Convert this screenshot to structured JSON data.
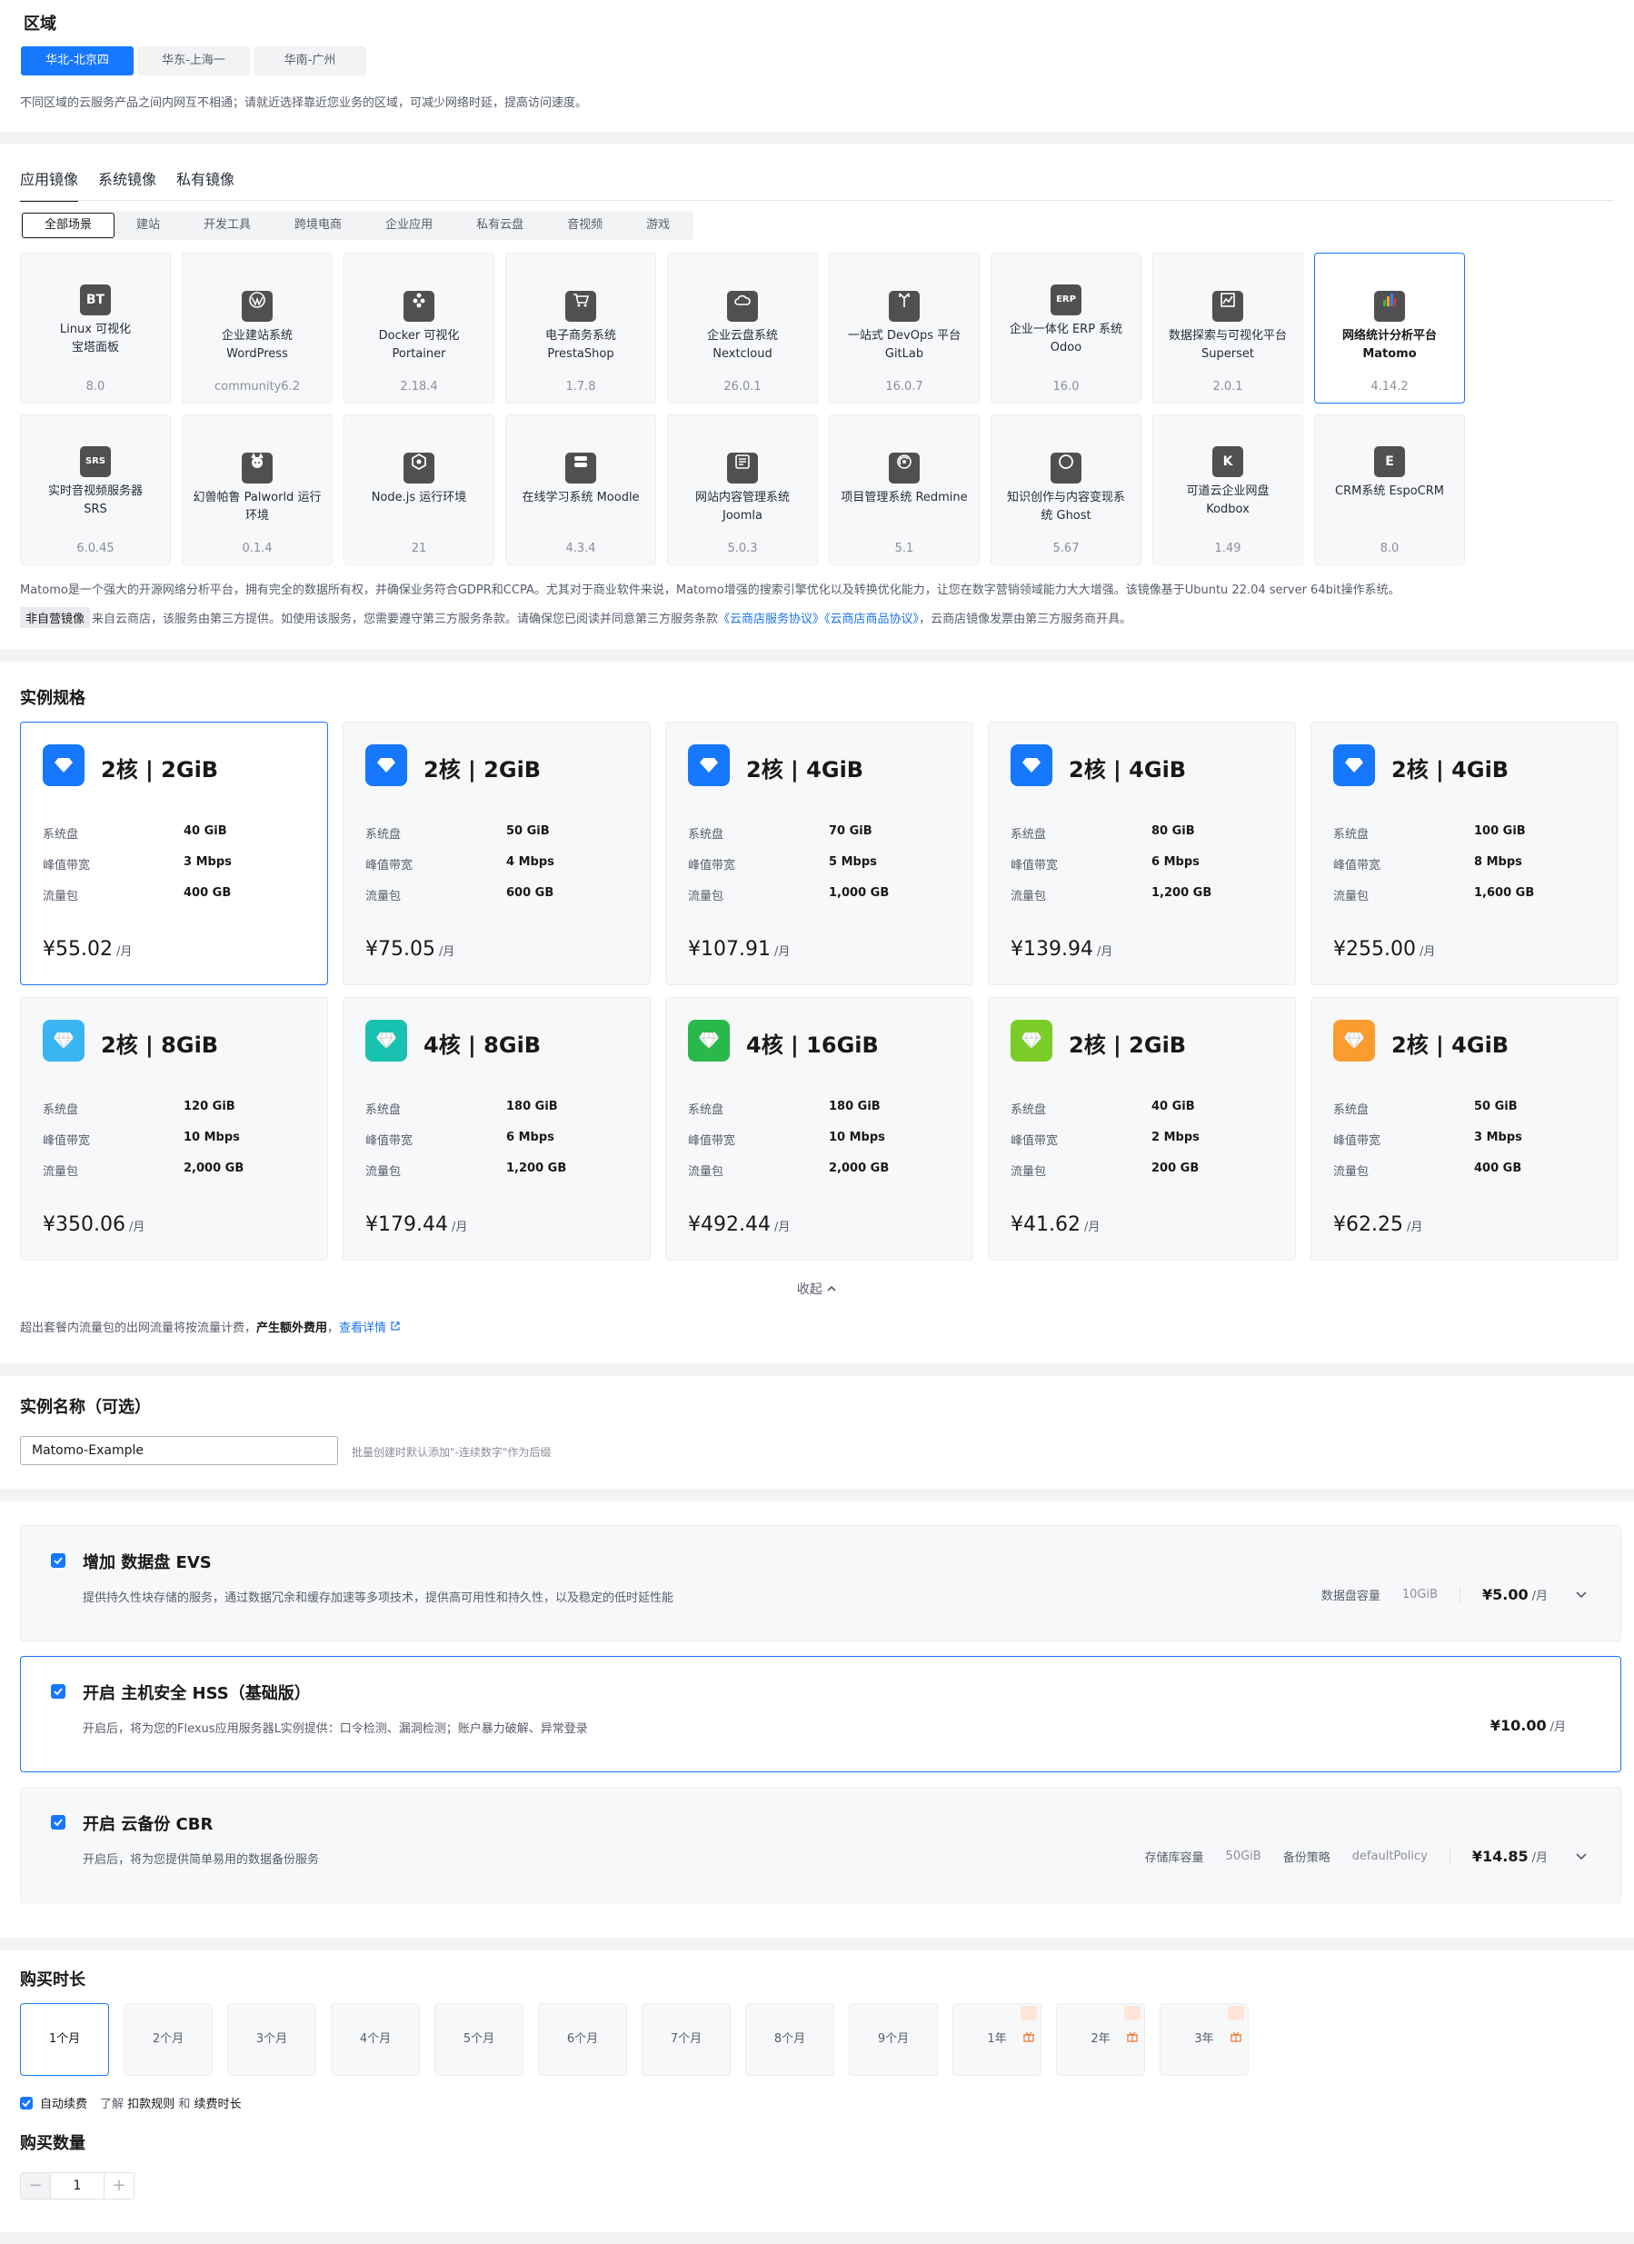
{
  "region": {
    "title": "区域",
    "tabs": [
      "华北-北京四",
      "华东-上海一",
      "华南-广州"
    ],
    "note": "不同区域的云服务产品之间内网互不相通；请就近选择靠近您业务的区域，可减少网络时延，提高访问速度。"
  },
  "image": {
    "tabs": [
      "应用镜像",
      "系统镜像",
      "私有镜像"
    ],
    "categories": [
      "全部场景",
      "建站",
      "开发工具",
      "跨境电商",
      "企业应用",
      "私有云盘",
      "音视频",
      "游戏"
    ],
    "items": [
      {
        "name1": "Linux 可视化",
        "name2": "宝塔面板",
        "version": "8.0",
        "icon": "bt-logo-icon",
        "glyph": "BT"
      },
      {
        "name1": "企业建站系统",
        "name2": "WordPress",
        "version": "community6.2",
        "icon": "wordpress-icon",
        "glyph": ""
      },
      {
        "name1": "Docker 可视化",
        "name2": "Portainer",
        "version": "2.18.4",
        "icon": "docker-icon",
        "glyph": ""
      },
      {
        "name1": "电子商务系统",
        "name2": "PrestaShop",
        "version": "1.7.8",
        "icon": "cart-icon",
        "glyph": ""
      },
      {
        "name1": "企业云盘系统",
        "name2": "Nextcloud",
        "version": "26.0.1",
        "icon": "cloud-icon",
        "glyph": ""
      },
      {
        "name1": "一站式 DevOps 平台",
        "name2": "GitLab",
        "version": "16.0.7",
        "icon": "branch-icon",
        "glyph": ""
      },
      {
        "name1": "企业一体化 ERP 系统",
        "name2": "Odoo",
        "version": "16.0",
        "icon": "erp-icon",
        "glyph": "ERP"
      },
      {
        "name1": "数据探索与可视化平台",
        "name2": "Superset",
        "version": "2.0.1",
        "icon": "chart-icon",
        "glyph": ""
      },
      {
        "name1": "网络统计分析平台",
        "name2": "Matomo",
        "version": "4.14.2",
        "icon": "matomo-bars-icon",
        "glyph": ""
      },
      {
        "name1": "实时音视频服务器",
        "name2": "SRS",
        "version": "6.0.45",
        "icon": "srs-icon",
        "glyph": "SRS"
      },
      {
        "name1": "幻兽帕鲁 Palworld 运行",
        "name2": "环境",
        "version": "0.1.4",
        "icon": "palworld-icon",
        "glyph": ""
      },
      {
        "name1": "Node.js 运行环境",
        "name2": "",
        "version": "21",
        "icon": "nodejs-icon",
        "glyph": ""
      },
      {
        "name1": "在线学习系统 Moodle",
        "name2": "",
        "version": "4.3.4",
        "icon": "moodle-icon",
        "glyph": ""
      },
      {
        "name1": "网站内容管理系统",
        "name2": "Joomla",
        "version": "5.0.3",
        "icon": "joomla-icon",
        "glyph": ""
      },
      {
        "name1": "项目管理系统 Redmine",
        "name2": "",
        "version": "5.1",
        "icon": "redmine-icon",
        "glyph": ""
      },
      {
        "name1": "知识创作与内容变现系",
        "name2": "统 Ghost",
        "version": "5.67",
        "icon": "ghost-icon",
        "glyph": ""
      },
      {
        "name1": "可道云企业网盘",
        "name2": "Kodbox",
        "version": "1.49",
        "icon": "kodbox-icon",
        "glyph": "K"
      },
      {
        "name1": "CRM系统 EspoCRM",
        "name2": "",
        "version": "8.0",
        "icon": "espocrm-icon",
        "glyph": "E"
      }
    ],
    "description": "Matomo是一个强大的开源网络分析平台，拥有完全的数据所有权，并确保业务符合GDPR和CCPA。尤其对于商业软件来说，Matomo增强的搜索引擎优化以及转换优化能力，让您在数字营销领域能力大大增强。该镜像基于Ubuntu 22.04 server 64bit操作系统。",
    "note_tag": "非自营镜像",
    "note_text": "来自云商店，该服务由第三方提供。如使用该服务，您需要遵守第三方服务条款。请确保您已阅读并同意第三方服务条款",
    "note_link1": "《云商店服务协议》",
    "note_link2": "《云商店商品协议》",
    "note_tail": "，云商店镜像发票由第三方服务商开具。"
  },
  "spec": {
    "title": "实例规格",
    "labels": {
      "disk": "系统盘",
      "bandwidth": "峰值带宽",
      "traffic": "流量包",
      "unit": "/月"
    },
    "items": [
      {
        "title": "2核 | 2GiB",
        "disk": "40 GiB",
        "bandwidth": "3 Mbps",
        "traffic": "400 GB",
        "price": "¥55.02",
        "color": "#1677ff",
        "shape": "diamond"
      },
      {
        "title": "2核 | 2GiB",
        "disk": "50 GiB",
        "bandwidth": "4 Mbps",
        "traffic": "600 GB",
        "price": "¥75.05",
        "color": "#1677ff",
        "shape": "diamond"
      },
      {
        "title": "2核 | 4GiB",
        "disk": "70 GiB",
        "bandwidth": "5 Mbps",
        "traffic": "1,000 GB",
        "price": "¥107.91",
        "color": "#1677ff",
        "shape": "diamond"
      },
      {
        "title": "2核 | 4GiB",
        "disk": "80 GiB",
        "bandwidth": "6 Mbps",
        "traffic": "1,200 GB",
        "price": "¥139.94",
        "color": "#1677ff",
        "shape": "diamond"
      },
      {
        "title": "2核 | 4GiB",
        "disk": "100 GiB",
        "bandwidth": "8 Mbps",
        "traffic": "1,600 GB",
        "price": "¥255.00",
        "color": "#1677ff",
        "shape": "diamond"
      },
      {
        "title": "2核 | 8GiB",
        "disk": "120 GiB",
        "bandwidth": "10 Mbps",
        "traffic": "2,000 GB",
        "price": "¥350.06",
        "color": "#3ab5f2",
        "shape": "gem"
      },
      {
        "title": "4核 | 8GiB",
        "disk": "180 GiB",
        "bandwidth": "6 Mbps",
        "traffic": "1,200 GB",
        "price": "¥179.44",
        "color": "#19c2b0",
        "shape": "gem"
      },
      {
        "title": "4核 | 16GiB",
        "disk": "180 GiB",
        "bandwidth": "10 Mbps",
        "traffic": "2,000 GB",
        "price": "¥492.44",
        "color": "#2bb84a",
        "shape": "gem"
      },
      {
        "title": "2核 | 2GiB",
        "disk": "40 GiB",
        "bandwidth": "2 Mbps",
        "traffic": "200 GB",
        "price": "¥41.62",
        "color": "#7ccc28",
        "shape": "gem"
      },
      {
        "title": "2核 | 4GiB",
        "disk": "50 GiB",
        "bandwidth": "3 Mbps",
        "traffic": "400 GB",
        "price": "¥62.25",
        "color": "#fa9c2e",
        "shape": "gem"
      }
    ],
    "collapse": "收起",
    "overage_prefix": "超出套餐内流量包的出网流量将按流量计费，",
    "overage_bold": "产生额外费用",
    "overage_link": "查看详情"
  },
  "name_section": {
    "title": "实例名称（可选）",
    "value": "Matomo-Example",
    "hint": "批量创建时默认添加\"-连续数字\"作为后缀"
  },
  "addons": [
    {
      "title": "增加 数据盘 EVS",
      "desc": "提供持久性块存储的服务，通过数据冗余和缓存加速等多项技术，提供高可用性和持久性，以及稳定的低时延性能",
      "label1": "数据盘容量",
      "value1": "10GiB",
      "label2": "",
      "value2": "",
      "price": "¥5.00",
      "unit": "/月"
    },
    {
      "title": "开启 主机安全 HSS（基础版）",
      "desc": "开启后，将为您的Flexus应用服务器L实例提供：口令检测、漏洞检测；账户暴力破解、异常登录",
      "label1": "",
      "value1": "",
      "label2": "",
      "value2": "",
      "price": "¥10.00",
      "unit": "/月"
    },
    {
      "title": "开启 云备份 CBR",
      "desc": "开启后，将为您提供简单易用的数据备份服务",
      "label1": "存储库容量",
      "value1": "50GiB",
      "label2": "备份策略",
      "value2": "defaultPolicy",
      "price": "¥14.85",
      "unit": "/月"
    }
  ],
  "duration": {
    "title": "购买时长",
    "options": [
      "1个月",
      "2个月",
      "3个月",
      "4个月",
      "5个月",
      "6个月",
      "7个月",
      "8个月",
      "9个月",
      "1年",
      "2年",
      "3年"
    ],
    "auto_renew": "自动续费",
    "learn": "了解",
    "rule1": "扣款规则",
    "and": "和",
    "rule2": "续费时长"
  },
  "quantity": {
    "title": "购买数量",
    "value": "1",
    "minus": "−",
    "plus": "+"
  }
}
